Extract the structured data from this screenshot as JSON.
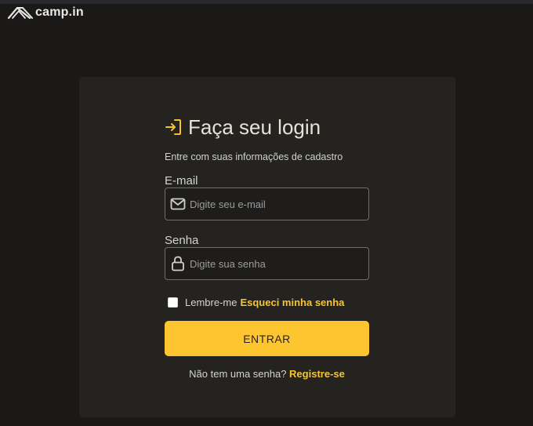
{
  "header": {
    "logo_text": "camp.in",
    "logo_icon": "tent-icon"
  },
  "login": {
    "title": "Faça seu login",
    "title_icon": "sign-in-icon",
    "subtitle": "Entre com suas informações de cadastro",
    "email": {
      "label": "E-mail",
      "placeholder": "Digite seu e-mail",
      "value": "",
      "icon": "mail-icon"
    },
    "password": {
      "label": "Senha",
      "placeholder": "Digite sua senha",
      "value": "",
      "icon": "lock-icon"
    },
    "remember_label": "Lembre-me",
    "remember_checked": false,
    "forgot_label": "Esqueci minha senha",
    "submit_label": "ENTRAR",
    "register_text": "Não tem uma senha?",
    "register_link": "Registre-se"
  },
  "colors": {
    "accent": "#fdc52f",
    "background": "#1a1918",
    "card": "#242320"
  }
}
